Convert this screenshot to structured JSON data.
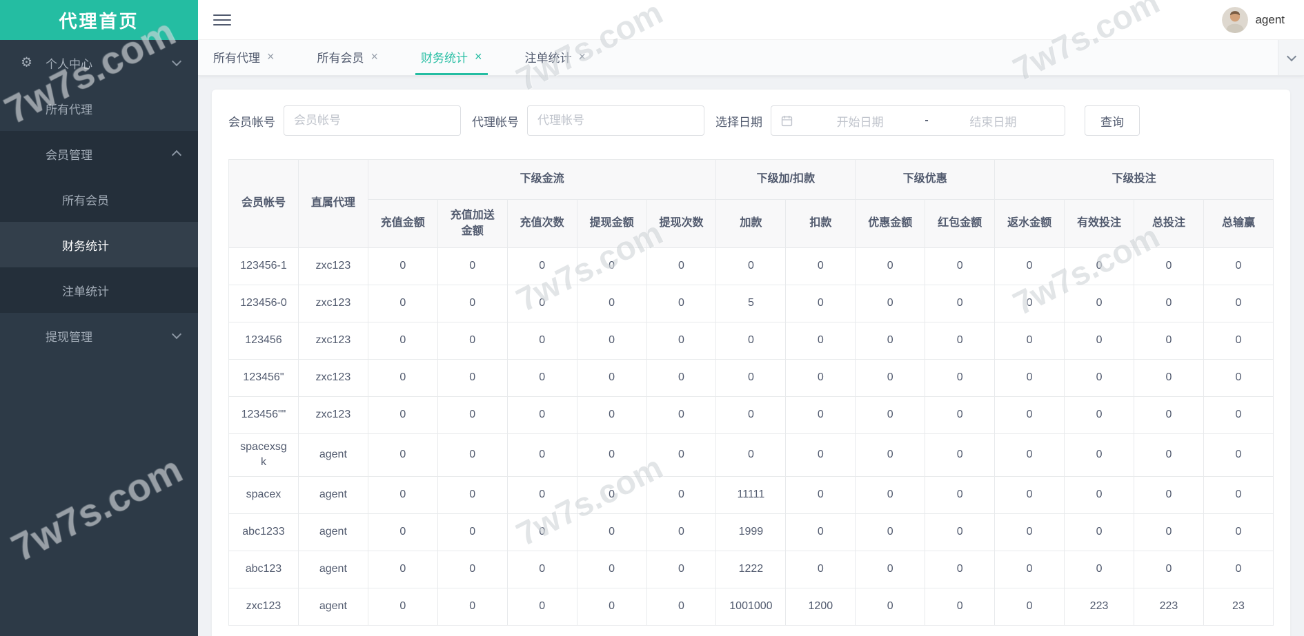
{
  "app": {
    "title": "代理首页",
    "watermark": "7w7s.com"
  },
  "colors": {
    "accent": "#24bda2",
    "sidebar_bg": "#2d3a47",
    "sidebar_submenu_bg": "#242f3a",
    "sidebar_active_bg": "#333f4b",
    "table_border": "#e8eaec",
    "table_header_bg": "#f8f8f9",
    "text": "#515a6e"
  },
  "icons": {
    "gear": "⚙",
    "close": "×"
  },
  "header": {
    "username": "agent"
  },
  "sidebar": {
    "items": [
      {
        "label": "个人中心"
      },
      {
        "label": "所有代理"
      },
      {
        "label": "会员管理"
      },
      {
        "label": "所有会员"
      },
      {
        "label": "财务统计",
        "active": true
      },
      {
        "label": "注单统计"
      },
      {
        "label": "提现管理"
      }
    ]
  },
  "tabs": [
    {
      "label": "所有代理"
    },
    {
      "label": "所有会员"
    },
    {
      "label": "财务统计",
      "active": true
    },
    {
      "label": "注单统计"
    }
  ],
  "filters": {
    "member_label": "会员帐号",
    "member_placeholder": "会员帐号",
    "agent_label": "代理帐号",
    "agent_placeholder": "代理帐号",
    "date_label": "选择日期",
    "date_start_placeholder": "开始日期",
    "date_separator": "-",
    "date_end_placeholder": "结束日期",
    "search_button": "查询"
  },
  "table": {
    "fixed_columns": [
      "会员帐号",
      "直属代理"
    ],
    "groups": [
      {
        "label": "下级金流",
        "span": 5
      },
      {
        "label": "下级加/扣款",
        "span": 2
      },
      {
        "label": "下级优惠",
        "span": 2
      },
      {
        "label": "下级投注",
        "span": 4
      }
    ],
    "sub_columns": [
      "充值金额",
      "充值加送金额",
      "充值次数",
      "提现金额",
      "提现次数",
      "加款",
      "扣款",
      "优惠金额",
      "红包金额",
      "返水金额",
      "有效投注",
      "总投注",
      "总输赢"
    ],
    "rows": [
      [
        "123456-1",
        "zxc123",
        "0",
        "0",
        "0",
        "0",
        "0",
        "0",
        "0",
        "0",
        "0",
        "0",
        "0",
        "0",
        "0"
      ],
      [
        "123456-0",
        "zxc123",
        "0",
        "0",
        "0",
        "0",
        "0",
        "5",
        "0",
        "0",
        "0",
        "0",
        "0",
        "0",
        "0"
      ],
      [
        "123456",
        "zxc123",
        "0",
        "0",
        "0",
        "0",
        "0",
        "0",
        "0",
        "0",
        "0",
        "0",
        "0",
        "0",
        "0"
      ],
      [
        "123456\"",
        "zxc123",
        "0",
        "0",
        "0",
        "0",
        "0",
        "0",
        "0",
        "0",
        "0",
        "0",
        "0",
        "0",
        "0"
      ],
      [
        "123456\"\"",
        "zxc123",
        "0",
        "0",
        "0",
        "0",
        "0",
        "0",
        "0",
        "0",
        "0",
        "0",
        "0",
        "0",
        "0"
      ],
      [
        "spacexsgk",
        "agent",
        "0",
        "0",
        "0",
        "0",
        "0",
        "0",
        "0",
        "0",
        "0",
        "0",
        "0",
        "0",
        "0"
      ],
      [
        "spacex",
        "agent",
        "0",
        "0",
        "0",
        "0",
        "0",
        "11111",
        "0",
        "0",
        "0",
        "0",
        "0",
        "0",
        "0"
      ],
      [
        "abc1233",
        "agent",
        "0",
        "0",
        "0",
        "0",
        "0",
        "1999",
        "0",
        "0",
        "0",
        "0",
        "0",
        "0",
        "0"
      ],
      [
        "abc123",
        "agent",
        "0",
        "0",
        "0",
        "0",
        "0",
        "1222",
        "0",
        "0",
        "0",
        "0",
        "0",
        "0",
        "0"
      ],
      [
        "zxc123",
        "agent",
        "0",
        "0",
        "0",
        "0",
        "0",
        "1001000",
        "1200",
        "0",
        "0",
        "0",
        "223",
        "223",
        "23"
      ]
    ]
  }
}
